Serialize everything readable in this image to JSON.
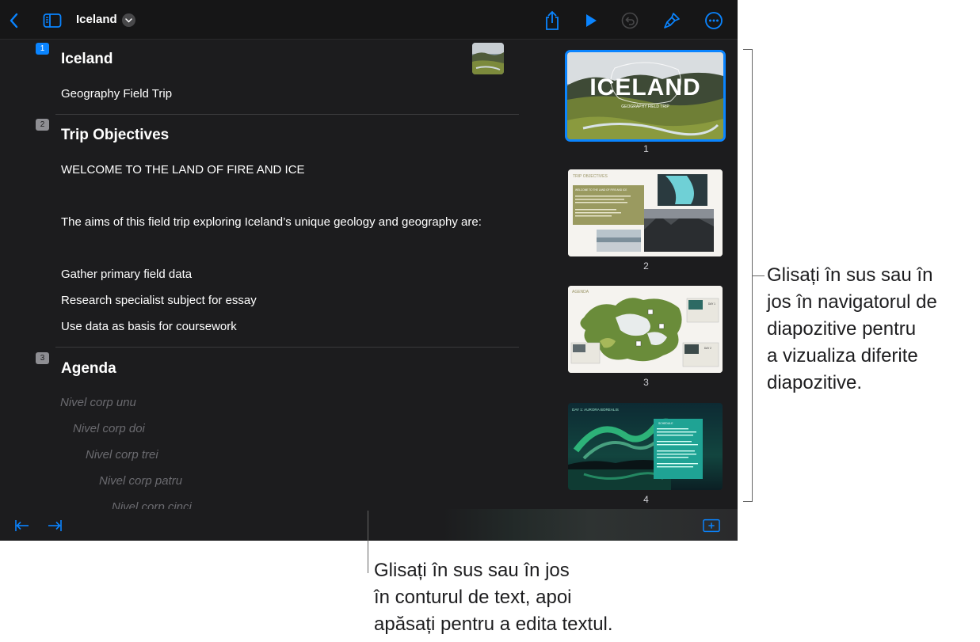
{
  "toolbar": {
    "title": "Iceland",
    "back_icon": "chevron-left-icon",
    "sidebar_icon": "sidebar-icon",
    "share_icon": "share-icon",
    "play_icon": "play-icon",
    "undo_icon": "undo-icon",
    "format_icon": "paintbrush-icon",
    "more_icon": "ellipsis-circle-icon"
  },
  "outline": {
    "slides": [
      {
        "number": "1",
        "title": "Iceland",
        "lines": [
          "Geography Field Trip"
        ]
      },
      {
        "number": "2",
        "title": "Trip Objectives",
        "lines": [
          "WELCOME TO THE LAND OF FIRE AND ICE",
          "The aims of this field trip exploring Iceland’s unique geology and geography are:",
          "Gather primary field data",
          "Research specialist subject for essay",
          "Use data as basis for coursework"
        ]
      },
      {
        "number": "3",
        "title": "Agenda",
        "placeholders": [
          "Nivel corp unu",
          "Nivel corp doi",
          "Nivel corp trei",
          "Nivel corp patru",
          "Nivel corp cinci"
        ]
      }
    ]
  },
  "navigator": {
    "slides": [
      {
        "number": "1",
        "heading": "ICELAND",
        "sub": "GEOGRAPHY FIELD TRIP"
      },
      {
        "number": "2",
        "heading": "TRIP OBJECTIVES",
        "box_title": "WELCOME TO THE LAND OF FIRE AND ICE"
      },
      {
        "number": "3",
        "heading": "AGENDA",
        "day1": "DAY 1",
        "day2": "DAY 2"
      },
      {
        "number": "4",
        "heading": "DAY 1: AURORA BOREALIS",
        "box_title": "SCHEDULE"
      }
    ]
  },
  "bottombar": {
    "outdent_icon": "outdent-icon",
    "indent_icon": "indent-icon",
    "add_slide_icon": "add-slide-icon"
  },
  "callouts": {
    "navigator": [
      "Glisați în sus sau în",
      "jos în navigatorul de",
      "diapozitive pentru",
      "a vizualiza diferite",
      "diapozitive."
    ],
    "outline": [
      "Glisați în sus sau în jos",
      "în conturul de text, apoi",
      "apăsați pentru a edita textul."
    ]
  },
  "colors": {
    "accent": "#0a84ff",
    "background": "#1c1c1e"
  }
}
